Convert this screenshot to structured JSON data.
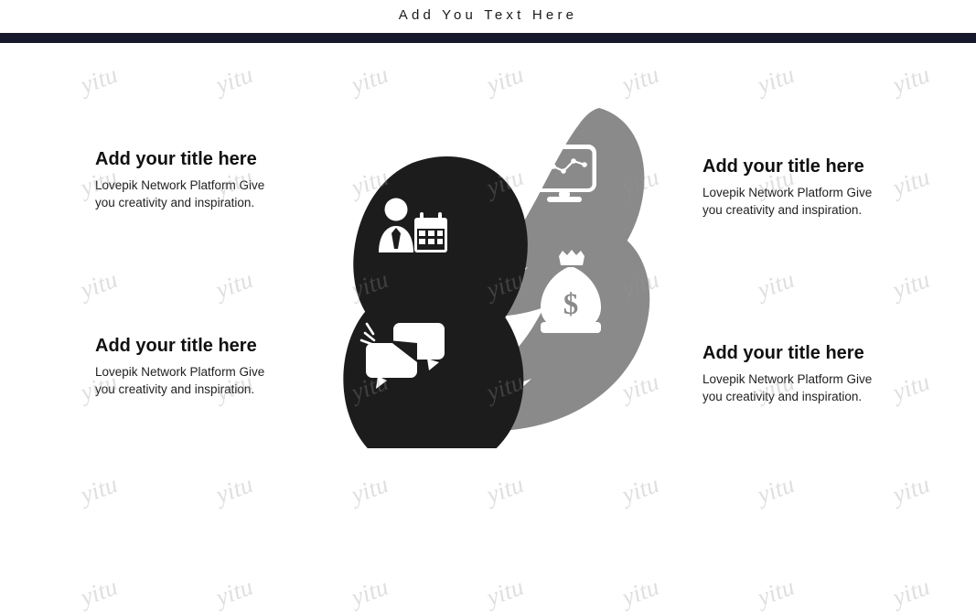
{
  "header": {
    "title": "Add You Text Here",
    "rule_color": "#16182b"
  },
  "theme": {
    "background": "#ffffff",
    "dark_petal": "#1c1c1c",
    "gray_petal": "#8a8a8a",
    "icon_color": "#ffffff",
    "title_color": "#101010",
    "body_color": "#1f1f1f"
  },
  "blocks": [
    {
      "id": "top-left",
      "title": "Add your title here",
      "body_line1": "Lovepik Network Platform Give",
      "body_line2": "you creativity and inspiration.",
      "align": "left"
    },
    {
      "id": "top-right",
      "title": "Add your title here",
      "body_line1": "Lovepik Network Platform Give",
      "body_line2": "you creativity and inspiration.",
      "align": "left"
    },
    {
      "id": "bottom-left",
      "title": "Add your title here",
      "body_line1": "Lovepik Network Platform Give",
      "body_line2": "you creativity and inspiration.",
      "align": "left"
    },
    {
      "id": "bottom-right",
      "title": "Add your title here",
      "body_line1": "Lovepik Network Platform Give",
      "body_line2": "you creativity and inspiration.",
      "align": "left"
    }
  ],
  "petals": [
    {
      "id": "petal-top-right",
      "color": "#8a8a8a",
      "icon": "monitor-chart-icon"
    },
    {
      "id": "petal-top-left",
      "color": "#1c1c1c",
      "icon": "person-calendar-icon"
    },
    {
      "id": "petal-bottom-right",
      "color": "#8a8a8a",
      "icon": "money-bag-icon"
    },
    {
      "id": "petal-bottom-left",
      "color": "#1c1c1c",
      "icon": "chat-bubbles-icon"
    }
  ],
  "watermark": {
    "text": "yitu"
  }
}
